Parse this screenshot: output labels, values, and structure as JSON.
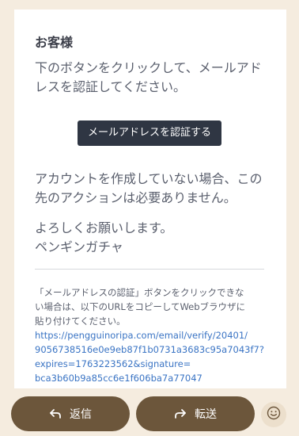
{
  "email": {
    "greeting": "お客様",
    "line1": "下のボタンをクリックして、メールアド",
    "line2": "レスを認証してください。",
    "verify_button": "メールアドレスを認証する",
    "line3": "アカウントを作成していない場合、この",
    "line4": "先のアクションは必要ありません。",
    "closing": "よろしくお願いします。",
    "sender": "ペンギンガチャ",
    "note_line1": "「メールアドレスの認証」ボタンをクリックできな",
    "note_line2": "い場合は、以下のURLをコピーしてWebブラウザに",
    "note_line3": "貼り付けてください。",
    "url_line1": "https://pengguinoripa.com/email/verify/20401/",
    "url_line2": "9056738516e0e9eb87f1b0731a3683c95a7043f7?",
    "url_line3": "expires=1763223562&signature=",
    "url_line4": "bca3b60b9a85cc6e1f606ba7a77047"
  },
  "actions": {
    "reply_label": "返信",
    "forward_label": "転送"
  },
  "icons": {
    "reply": "reply-arrow-icon",
    "forward": "forward-arrow-icon",
    "emoji": "smiley-face-icon"
  },
  "colors": {
    "background": "#f5ecdf",
    "button_dark": "#2f3643",
    "pill": "#6c563b",
    "link": "#3a74c4"
  }
}
